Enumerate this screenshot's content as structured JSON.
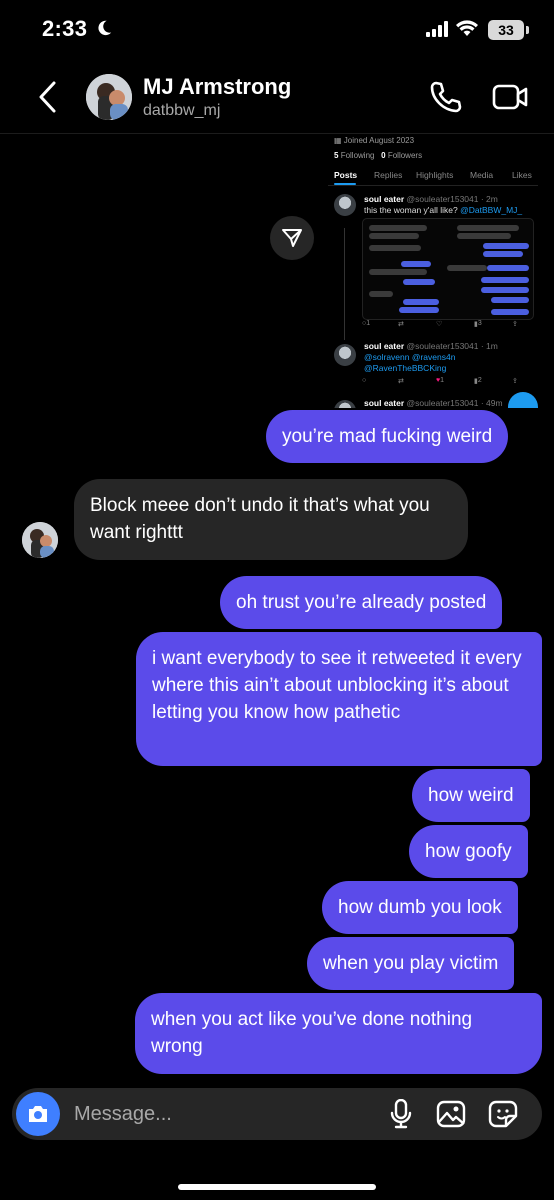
{
  "status_bar": {
    "time": "2:33",
    "battery": "33"
  },
  "header": {
    "name": "MJ Armstrong",
    "username": "datbbw_mj"
  },
  "shared_post": {
    "joined": "Joined August 2023",
    "following_count": "5",
    "following_label": "Following",
    "followers_count": "0",
    "followers_label": "Followers",
    "tabs": [
      "Posts",
      "Replies",
      "Highlights",
      "Media",
      "Likes"
    ],
    "post1": {
      "author": "soul eater",
      "handle": "@souleater153041 · 2m",
      "text_prefix": "this the woman y'all like?",
      "mention": "@DatBBW_MJ_",
      "stats": {
        "replies": "1",
        "likes": "",
        "views": "3"
      }
    },
    "post2": {
      "author": "soul eater",
      "handle": "@souleater153041 · 1m",
      "line1": "@solravenn @ravens4n",
      "line2": "@RavenTheBBCKing",
      "stats": {
        "likes": "1",
        "views": "2"
      }
    },
    "post3": {
      "author": "soul eater",
      "handle": "@souleater153041 · 49m"
    }
  },
  "messages": [
    {
      "side": "sent",
      "text": "you’re mad fucking weird"
    },
    {
      "side": "received",
      "text": "Block meee don’t undo it that’s what you want righttt"
    },
    {
      "side": "sent",
      "text": "oh trust you’re already posted"
    },
    {
      "side": "sent",
      "text": "i want everybody to see it retweeted it every where this ain’t about unblocking it’s about letting you know how pathetic"
    },
    {
      "side": "sent",
      "text": "how weird"
    },
    {
      "side": "sent",
      "text": "how goofy"
    },
    {
      "side": "sent",
      "text": "how dumb you look"
    },
    {
      "side": "sent",
      "text": "when you play victim"
    },
    {
      "side": "sent",
      "text": "when you act like you’ve done nothing wrong"
    }
  ],
  "composer": {
    "placeholder": "Message..."
  },
  "colors": {
    "sent_bubble": "#5b4bea",
    "received_bubble": "#262626",
    "camera_button": "#3f7fff",
    "link": "#1d9bf0"
  }
}
